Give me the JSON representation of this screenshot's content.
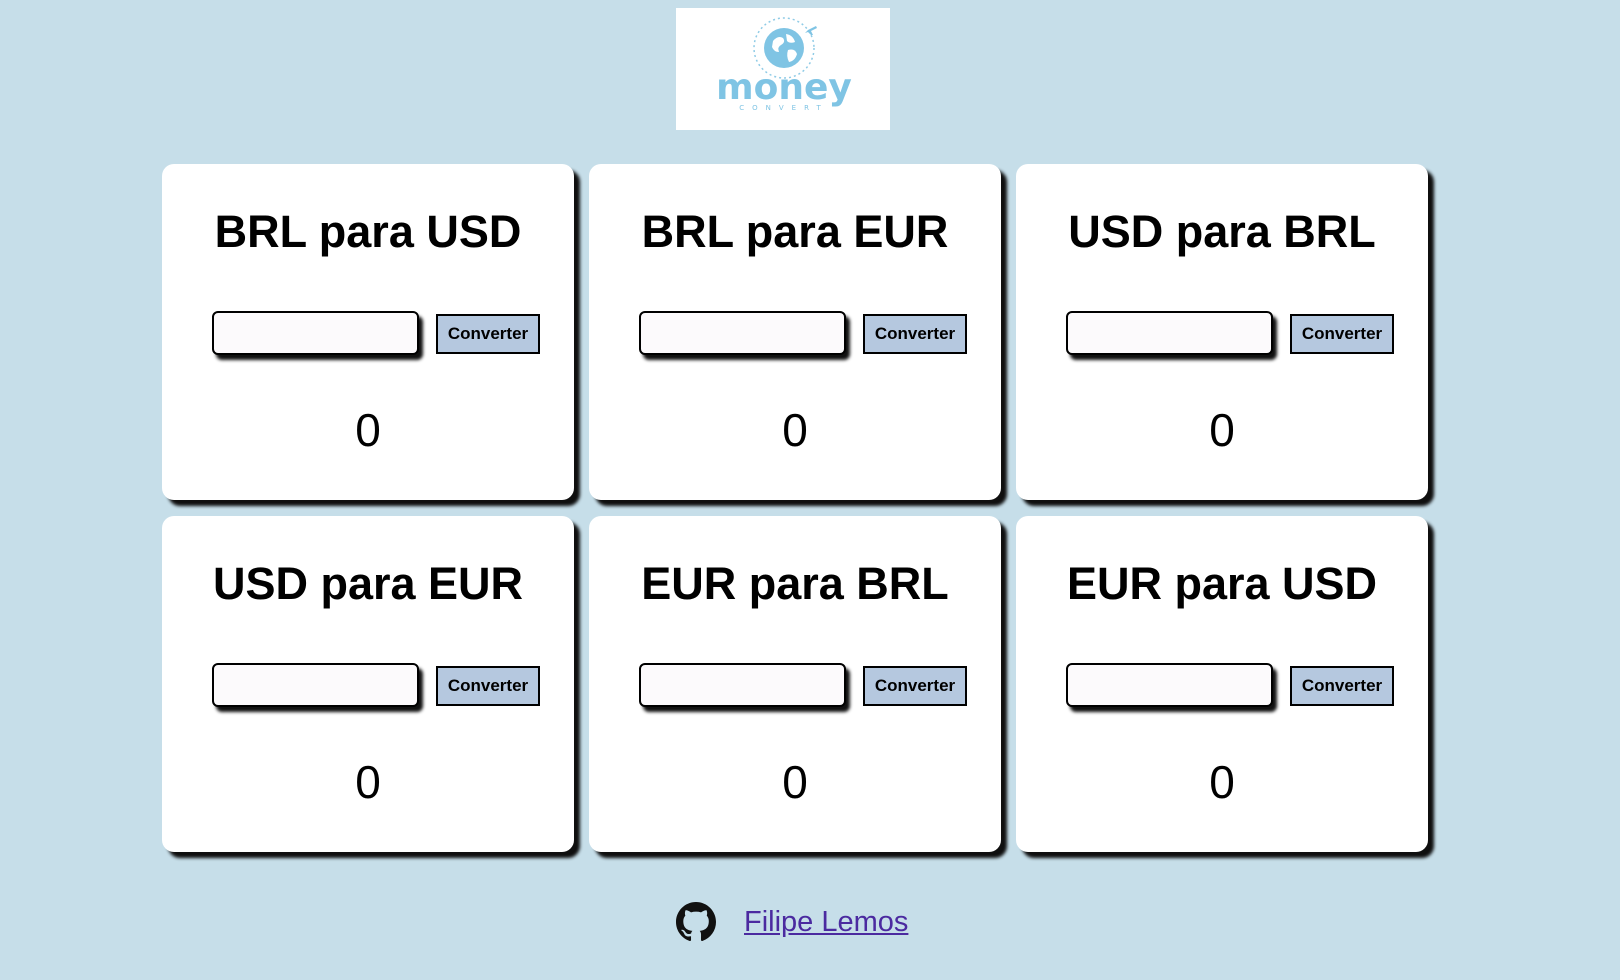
{
  "logo": {
    "wordmark": "money",
    "tagline": "CONVERT",
    "icon": "globe-airplane-icon",
    "color": "#7fc4e4"
  },
  "converters": [
    {
      "title": "BRL para USD",
      "button_label": "Converter",
      "input_value": "",
      "result": "0"
    },
    {
      "title": "BRL para EUR",
      "button_label": "Converter",
      "input_value": "",
      "result": "0"
    },
    {
      "title": "USD para BRL",
      "button_label": "Converter",
      "input_value": "",
      "result": "0"
    },
    {
      "title": "USD para EUR",
      "button_label": "Converter",
      "input_value": "",
      "result": "0"
    },
    {
      "title": "EUR para BRL",
      "button_label": "Converter",
      "input_value": "",
      "result": "0"
    },
    {
      "title": "EUR para USD",
      "button_label": "Converter",
      "input_value": "",
      "result": "0"
    }
  ],
  "footer": {
    "icon": "github-icon",
    "link_text": "Filipe Lemos"
  },
  "colors": {
    "background": "#c6dee9",
    "card": "#ffffff",
    "button": "#b5c8df",
    "link": "#4b2aa0"
  }
}
